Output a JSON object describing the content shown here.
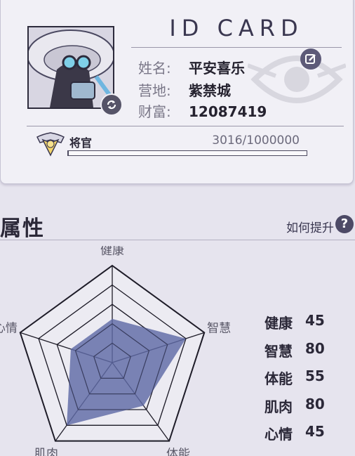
{
  "card": {
    "title": "ID CARD",
    "fields": [
      {
        "label": "姓名:",
        "value": "平安喜乐"
      },
      {
        "label": "营地:",
        "value": "紫禁城"
      },
      {
        "label": "财富:",
        "value": "12087419"
      }
    ],
    "rank": {
      "name": "将官",
      "progress_text": "3016/1000000",
      "progress_fraction": 0.003
    },
    "icons": {
      "edit": "edit-icon",
      "refresh": "refresh-icon",
      "rank_badge": "rank-badge-icon",
      "avatar": "avatar-image"
    }
  },
  "attributes": {
    "title": "属性",
    "help_text": "如何提升",
    "help_icon": "help-icon",
    "axes": [
      "健康",
      "智慧",
      "体能",
      "肌肉",
      "心情"
    ],
    "stats": [
      {
        "name": "健康",
        "value": 45
      },
      {
        "name": "智慧",
        "value": 80
      },
      {
        "name": "体能",
        "value": 55
      },
      {
        "name": "肌肉",
        "value": 80
      },
      {
        "name": "心情",
        "value": 45
      }
    ],
    "max": 100,
    "fill_color": "#5f6aa6"
  }
}
